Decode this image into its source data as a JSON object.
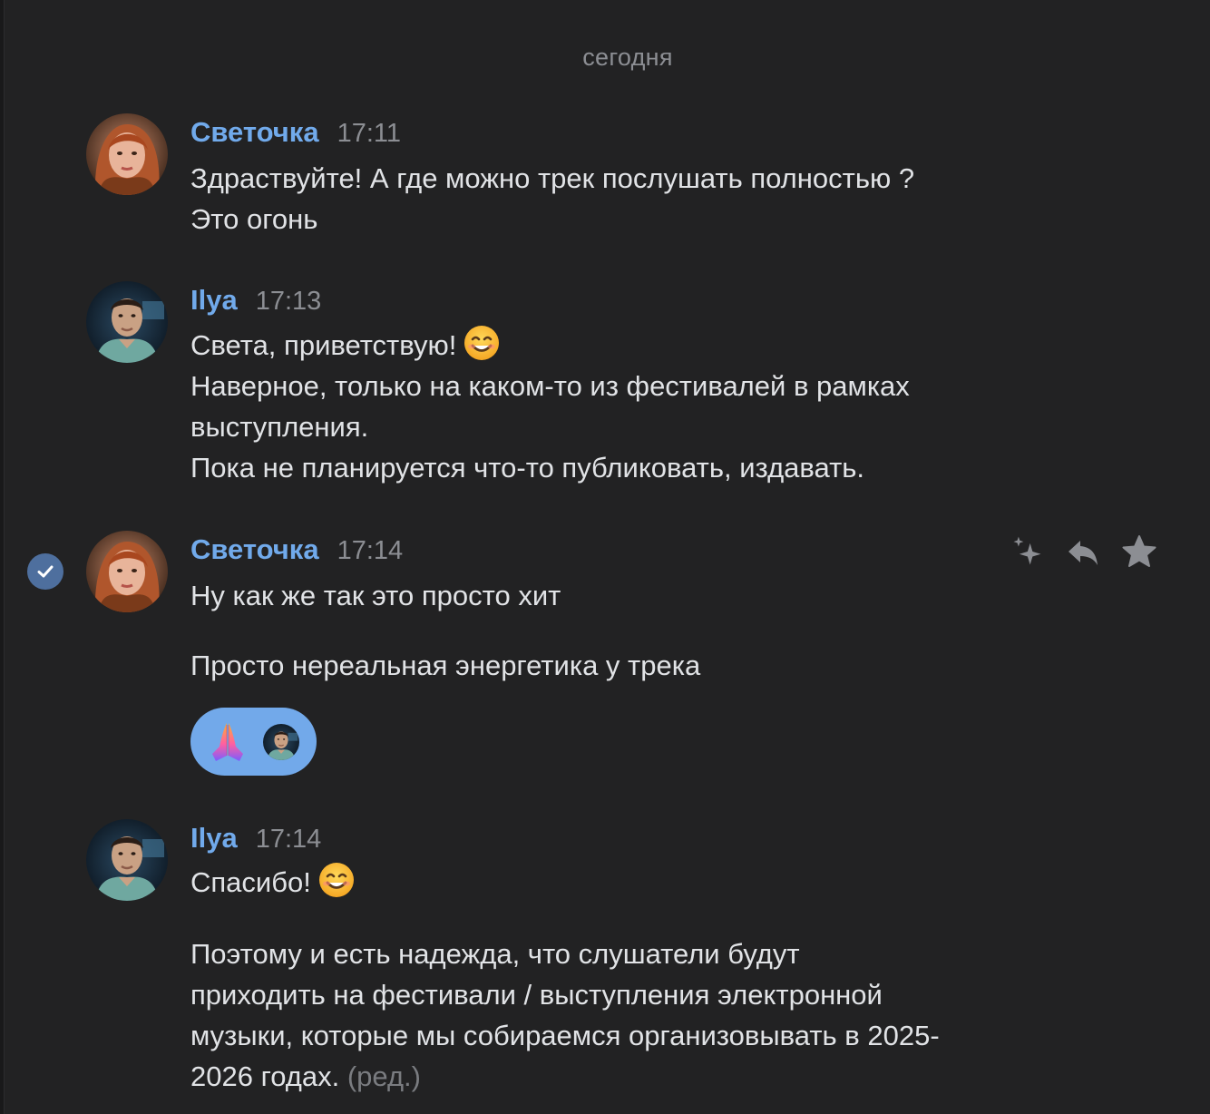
{
  "date_separator": "сегодня",
  "messages": [
    {
      "author": "Светочка",
      "time": "17:11",
      "lines": [
        "Здраствуйте! А где можно трек послушать полностью ?",
        "Это огонь"
      ]
    },
    {
      "author": "Ilya",
      "time": "17:13",
      "lines": [
        "Света, приветствую!",
        "Наверное, только на каком-то из фестивалей в рамках",
        "выступления.",
        "Пока не планируется что-то публиковать, издавать."
      ]
    },
    {
      "author": "Светочка",
      "time": "17:14",
      "lines": [
        "Ну как же так это просто хит",
        "Просто нереальная энергетика у трека"
      ],
      "reaction": {
        "emoji": "pray",
        "user": "Ilya"
      }
    },
    {
      "author": "Ilya",
      "time": "17:14",
      "lines": [
        "Спасибо!",
        "Поэтому и есть надежда, что слушатели будут",
        "приходить на фестивали / выступления электронной",
        "музыки, которые мы собираемся организовывать в 2025-",
        "2026 годах."
      ],
      "edited": "(ред.)"
    }
  ],
  "actions": {
    "icons": [
      "sparkle-icon",
      "reply-icon",
      "star-icon"
    ]
  },
  "colors": {
    "background": "#222223",
    "author": "#71aaeb",
    "text": "#e1e3e6",
    "muted": "#8c8e93",
    "reaction_bg": "#72a9ea",
    "check": "#4e6f9e"
  }
}
